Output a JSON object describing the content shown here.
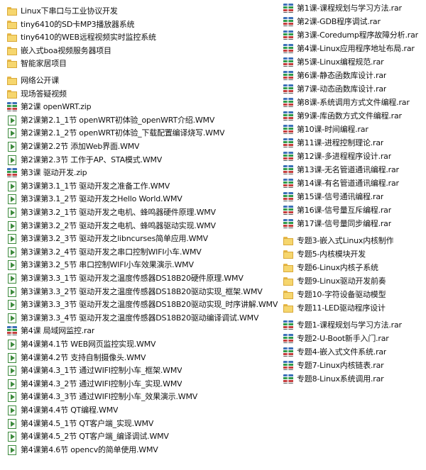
{
  "left_items": [
    {
      "type": "folder",
      "label": "Linux下串口与工业协议开发"
    },
    {
      "type": "folder",
      "label": "tiny6410的SD卡MP3播放器系统"
    },
    {
      "type": "folder",
      "label": "tiny6410的WEB远程视频实时监控系统"
    },
    {
      "type": "folder",
      "label": "嵌入式boa视频服务器项目"
    },
    {
      "type": "folder",
      "label": "智能家居项目"
    },
    {
      "type": "folder",
      "label": "网络公开课"
    },
    {
      "type": "folder",
      "label": "现场答疑视频"
    },
    {
      "type": "archive",
      "label": "第2课 openWRT.zip"
    },
    {
      "type": "video",
      "label": "第2课第2.1_1节 openWRT初体验_openWRT介绍.WMV"
    },
    {
      "type": "video",
      "label": "第2课第2.1_2节 openWRT初体验_下载配置编译烧写.WMV"
    },
    {
      "type": "video",
      "label": "第2课第2.2节 添加Web界面.WMV"
    },
    {
      "type": "video",
      "label": "第2课第2.3节 工作于AP、STA模式.WMV"
    },
    {
      "type": "archive",
      "label": "第3课 驱动开发.zip"
    },
    {
      "type": "video",
      "label": "第3课第3.1_1节 驱动开发之准备工作.WMV"
    },
    {
      "type": "video",
      "label": "第3课第3.1_2节 驱动开发之Hello World.WMV"
    },
    {
      "type": "video",
      "label": "第3课第3.2_1节 驱动开发之电机、蜂鸣器硬件原理.WMV"
    },
    {
      "type": "video",
      "label": "第3课第3.2_2节 驱动开发之电机、蜂鸣器驱动实现.WMV"
    },
    {
      "type": "video",
      "label": "第3课第3.2_3节 驱动开发之libncurses简单应用.WMV"
    },
    {
      "type": "video",
      "label": "第3课第3.2_4节 驱动开发之串口控制WIFI小车.WMV"
    },
    {
      "type": "video",
      "label": "第3课第3.2_5节 串口控制WIFI小车效果演示.WMV"
    },
    {
      "type": "video",
      "label": "第3课第3.3_1节 驱动开发之温度传感器DS18B20硬件原理.WMV"
    },
    {
      "type": "video",
      "label": "第3课第3.3_2节 驱动开发之温度传感器DS18B20驱动实现_框架.WMV"
    },
    {
      "type": "video",
      "label": "第3课第3.3_3节 驱动开发之温度传感器DS18B20驱动实现_时序讲解.WMV"
    },
    {
      "type": "video",
      "label": "第3课第3.3_4节 驱动开发之温度传感器DS18B20驱动编译调试.WMV"
    },
    {
      "type": "archive",
      "label": "第4课 局域网监控.rar"
    },
    {
      "type": "video",
      "label": "第4课第4.1节 WEB网页监控实现.WMV"
    },
    {
      "type": "video",
      "label": "第4课第4.2节 支持自制摄像头.WMV"
    },
    {
      "type": "video",
      "label": "第4课第4.3_1节 通过WIFI控制小车_框架.WMV"
    },
    {
      "type": "video",
      "label": "第4课第4.3_2节 通过WIFI控制小车_实现.WMV"
    },
    {
      "type": "video",
      "label": "第4课第4.3_3节 通过WIFI控制小车_效果演示.WMV"
    },
    {
      "type": "video",
      "label": "第4课第4.4节 QT编程.WMV"
    },
    {
      "type": "video",
      "label": "第4课第4.5_1节 QT客户端_实现.WMV"
    },
    {
      "type": "video",
      "label": "第4课第4.5_2节 QT客户端_编译调试.WMV"
    },
    {
      "type": "video",
      "label": "第4课第4.6节 opencv的简单使用.WMV"
    }
  ],
  "right_items": [
    {
      "type": "archive",
      "label": "第1课-课程规划与学习方法.rar"
    },
    {
      "type": "archive",
      "label": "第2课-GDB程序调试.rar"
    },
    {
      "type": "archive",
      "label": "第3课-Coredump程序故障分析.rar"
    },
    {
      "type": "archive",
      "label": "第4课-Linux应用程序地址布局.rar"
    },
    {
      "type": "archive",
      "label": "第5课-Linux编程规范.rar"
    },
    {
      "type": "archive",
      "label": "第6课-静态函数库设计.rar"
    },
    {
      "type": "archive",
      "label": "第7课-动态函数库设计.rar"
    },
    {
      "type": "archive",
      "label": "第8课-系统调用方式文件编程.rar"
    },
    {
      "type": "archive",
      "label": "第9课-库函数方式文件编程.rar"
    },
    {
      "type": "archive",
      "label": "第10课-时间编程.rar"
    },
    {
      "type": "archive",
      "label": "第11课-进程控制理论.rar"
    },
    {
      "type": "archive",
      "label": "第12课-多进程程序设计.rar"
    },
    {
      "type": "archive",
      "label": "第13课-无名管道通讯编程.rar"
    },
    {
      "type": "archive",
      "label": "第14课-有名管道通讯编程.rar"
    },
    {
      "type": "archive",
      "label": "第15课-信号通讯编程.rar"
    },
    {
      "type": "archive",
      "label": "第16课-信号量互斥编程.rar"
    },
    {
      "type": "archive",
      "label": "第17课-信号量同步编程.rar"
    },
    {
      "type": "folder",
      "label": "专题3-嵌入式Linux内核制作"
    },
    {
      "type": "folder",
      "label": "专题5-内核模块开发"
    },
    {
      "type": "folder",
      "label": "专题6-Linux内核子系统"
    },
    {
      "type": "folder",
      "label": "专题9-Linux驱动开发前奏"
    },
    {
      "type": "folder",
      "label": "专题10-字符设备驱动模型"
    },
    {
      "type": "folder",
      "label": "专题11-LED驱动程序设计"
    },
    {
      "type": "archive",
      "label": "专题1-课程规划与学习方法.rar"
    },
    {
      "type": "archive",
      "label": "专题2-U-Boot新手入门.rar"
    },
    {
      "type": "archive",
      "label": "专题4-嵌入式文件系统.rar"
    },
    {
      "type": "archive",
      "label": "专题7-Linux内核链表.rar"
    },
    {
      "type": "archive",
      "label": "专题8-Linux系统调用.rar"
    }
  ]
}
